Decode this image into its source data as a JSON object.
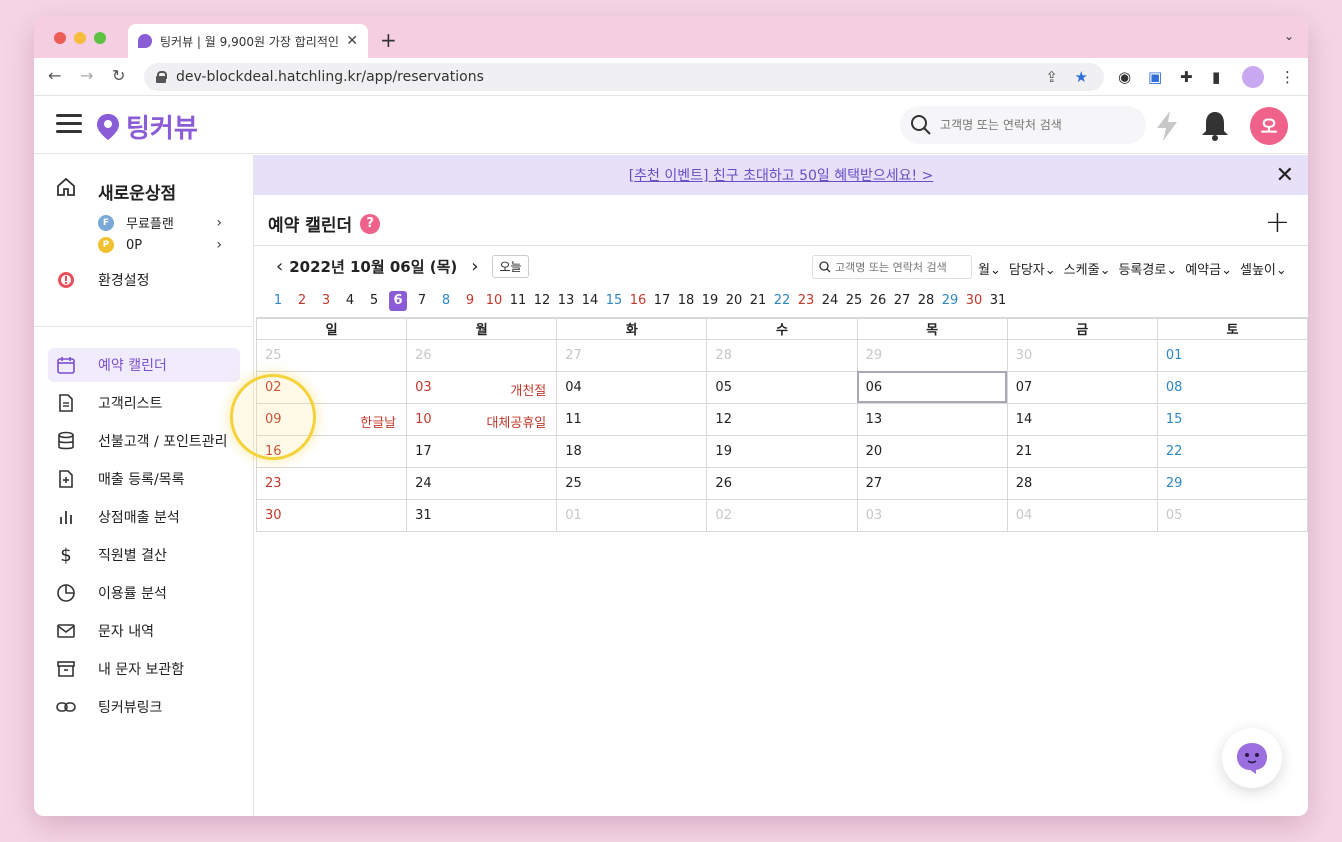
{
  "browser": {
    "tab_title": "팅커뷰 | 월 9,900원 가장 합리적인",
    "url": "dev-blockdeal.hatchling.kr/app/reservations"
  },
  "header": {
    "logo_text": "팅커뷰",
    "search_placeholder": "고객명 또는 연락처 검색",
    "avatar_initial": "오"
  },
  "sidebar": {
    "store_name": "새로운상점",
    "plan_label": "무료플랜",
    "points_label": "0P",
    "settings_label": "환경설정",
    "items": [
      {
        "label": "예약 캘린더",
        "icon": "calendar-icon",
        "active": true
      },
      {
        "label": "고객리스트",
        "icon": "document-icon",
        "active": false
      },
      {
        "label": "선불고객 / 포인트관리",
        "icon": "database-icon",
        "active": false
      },
      {
        "label": "매출 등록/목록",
        "icon": "file-plus-icon",
        "active": false
      },
      {
        "label": "상점매출 분석",
        "icon": "bar-chart-icon",
        "active": false
      },
      {
        "label": "직원별 결산",
        "icon": "dollar-icon",
        "active": false
      },
      {
        "label": "이용률 분석",
        "icon": "pie-chart-icon",
        "active": false
      },
      {
        "label": "문자 내역",
        "icon": "mail-icon",
        "active": false
      },
      {
        "label": "내 문자 보관함",
        "icon": "archive-icon",
        "active": false
      },
      {
        "label": "팅커뷰링크",
        "icon": "link-icon",
        "active": false
      }
    ]
  },
  "banner": {
    "text": "[추천 이벤트] 친구 초대하고 50일 혜택받으세요! >"
  },
  "page": {
    "title": "예약 캘린더",
    "help": "?",
    "add": "+"
  },
  "datebar": {
    "current_date": "2022년 10월 06일 (목)",
    "today_label": "오늘",
    "search_placeholder": "고객명 또는 연락처 검색",
    "filters": [
      "월",
      "담당자",
      "스케줄",
      "등록경로",
      "예약금",
      "셀높이"
    ]
  },
  "daystrip": [
    {
      "d": "1",
      "c": "blue"
    },
    {
      "d": "2",
      "c": "red"
    },
    {
      "d": "3",
      "c": "red"
    },
    {
      "d": "4",
      "c": "black"
    },
    {
      "d": "5",
      "c": "black"
    },
    {
      "d": "6",
      "c": "sel"
    },
    {
      "d": "7",
      "c": "black"
    },
    {
      "d": "8",
      "c": "blue"
    },
    {
      "d": "9",
      "c": "red"
    },
    {
      "d": "10",
      "c": "red"
    },
    {
      "d": "11",
      "c": "black"
    },
    {
      "d": "12",
      "c": "black"
    },
    {
      "d": "13",
      "c": "black"
    },
    {
      "d": "14",
      "c": "black"
    },
    {
      "d": "15",
      "c": "blue"
    },
    {
      "d": "16",
      "c": "red"
    },
    {
      "d": "17",
      "c": "black"
    },
    {
      "d": "18",
      "c": "black"
    },
    {
      "d": "19",
      "c": "black"
    },
    {
      "d": "20",
      "c": "black"
    },
    {
      "d": "21",
      "c": "black"
    },
    {
      "d": "22",
      "c": "blue"
    },
    {
      "d": "23",
      "c": "red"
    },
    {
      "d": "24",
      "c": "black"
    },
    {
      "d": "25",
      "c": "black"
    },
    {
      "d": "26",
      "c": "black"
    },
    {
      "d": "27",
      "c": "black"
    },
    {
      "d": "28",
      "c": "black"
    },
    {
      "d": "29",
      "c": "blue"
    },
    {
      "d": "30",
      "c": "red"
    },
    {
      "d": "31",
      "c": "black"
    }
  ],
  "calendar": {
    "weekdays": [
      "일",
      "월",
      "화",
      "수",
      "목",
      "금",
      "토"
    ],
    "weeks": [
      [
        {
          "d": "25",
          "c": "gray"
        },
        {
          "d": "26",
          "c": "gray"
        },
        {
          "d": "27",
          "c": "gray"
        },
        {
          "d": "28",
          "c": "gray"
        },
        {
          "d": "29",
          "c": "gray"
        },
        {
          "d": "30",
          "c": "gray"
        },
        {
          "d": "01",
          "c": "blue"
        }
      ],
      [
        {
          "d": "02",
          "c": "red"
        },
        {
          "d": "03",
          "c": "red",
          "holiday": "개천절"
        },
        {
          "d": "04",
          "c": "black"
        },
        {
          "d": "05",
          "c": "black"
        },
        {
          "d": "06",
          "c": "black",
          "selected": true
        },
        {
          "d": "07",
          "c": "black"
        },
        {
          "d": "08",
          "c": "blue"
        }
      ],
      [
        {
          "d": "09",
          "c": "red",
          "holiday": "한글날"
        },
        {
          "d": "10",
          "c": "red",
          "holiday": "대체공휴일"
        },
        {
          "d": "11",
          "c": "black"
        },
        {
          "d": "12",
          "c": "black"
        },
        {
          "d": "13",
          "c": "black"
        },
        {
          "d": "14",
          "c": "black"
        },
        {
          "d": "15",
          "c": "blue"
        }
      ],
      [
        {
          "d": "16",
          "c": "red"
        },
        {
          "d": "17",
          "c": "black"
        },
        {
          "d": "18",
          "c": "black"
        },
        {
          "d": "19",
          "c": "black"
        },
        {
          "d": "20",
          "c": "black"
        },
        {
          "d": "21",
          "c": "black"
        },
        {
          "d": "22",
          "c": "blue"
        }
      ],
      [
        {
          "d": "23",
          "c": "red"
        },
        {
          "d": "24",
          "c": "black"
        },
        {
          "d": "25",
          "c": "black"
        },
        {
          "d": "26",
          "c": "black"
        },
        {
          "d": "27",
          "c": "black"
        },
        {
          "d": "28",
          "c": "black"
        },
        {
          "d": "29",
          "c": "blue"
        }
      ],
      [
        {
          "d": "30",
          "c": "red"
        },
        {
          "d": "31",
          "c": "black"
        },
        {
          "d": "01",
          "c": "gray"
        },
        {
          "d": "02",
          "c": "gray"
        },
        {
          "d": "03",
          "c": "gray"
        },
        {
          "d": "04",
          "c": "gray"
        },
        {
          "d": "05",
          "c": "gray"
        }
      ]
    ]
  },
  "colors": {
    "brand": "#8a5cd6",
    "accent_pink": "#f0628a",
    "holiday_red": "#c0392b",
    "saturday_blue": "#2f86c4"
  }
}
